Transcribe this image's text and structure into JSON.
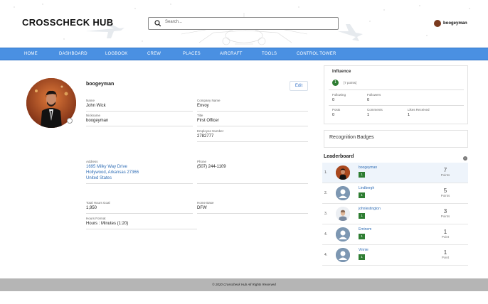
{
  "app": {
    "logo": "CROSSCHECK HUB"
  },
  "search": {
    "placeholder": "Search..."
  },
  "header_user": {
    "name": "boogeyman"
  },
  "nav": [
    "HOME",
    "DASHBOARD",
    "LOGBOOK",
    "CREW",
    "PLACES",
    "AIRCRAFT",
    "TOOLS",
    "CONTROL TOWER"
  ],
  "profile": {
    "username": "boogeyman",
    "edit_label": "Edit",
    "name_label": "Name",
    "name": "John Wick",
    "company_label": "Company Name",
    "company": "Envoy",
    "nickname_label": "Nickname",
    "nickname": "boogeyman",
    "title_label": "Title",
    "title": "First Officer",
    "employee_label": "Employee Number",
    "employee": "2782777",
    "address_label": "Address",
    "address_line1": "1695 Milky Way Drive",
    "address_line2": "Hollywood, Arkansas 27366",
    "address_line3": "United States",
    "phone_label": "Phone",
    "phone": "(507) 244-1109",
    "goal_label": "Total Hours Goal",
    "goal": "1,950",
    "base_label": "Home Base",
    "base": "DFW",
    "format_label": "Hours Format",
    "format": "Hours : Minutes (1:20)"
  },
  "influence": {
    "title": "Influence",
    "level": "1",
    "points": "[7 points]",
    "following_label": "Following",
    "following": "0",
    "followers_label": "Followers",
    "followers": "0",
    "posts_label": "Posts",
    "posts": "0",
    "comments_label": "Comments",
    "comments": "1",
    "likes_label": "Likes Received",
    "likes": "1"
  },
  "badges": {
    "title": "Recognition Badges"
  },
  "leaderboard": {
    "title": "Leaderboard",
    "info": "i",
    "rows": [
      {
        "rank": "1.",
        "name": "boogeyman",
        "level": "1",
        "points": "7",
        "points_label": "Points"
      },
      {
        "rank": "2.",
        "name": "Lindbergh",
        "level": "1",
        "points": "5",
        "points_label": "Points"
      },
      {
        "rank": "3.",
        "name": "johnlestington",
        "level": "1",
        "points": "3",
        "points_label": "Points"
      },
      {
        "rank": "4.",
        "name": "Eminem",
        "level": "1",
        "points": "1",
        "points_label": "Point"
      },
      {
        "rank": "4.",
        "name": "Vinnie",
        "level": "1",
        "points": "1",
        "points_label": "Point"
      }
    ]
  },
  "footer": {
    "text": "© 2020 Crosscheck Hub All Rights Reserved"
  }
}
